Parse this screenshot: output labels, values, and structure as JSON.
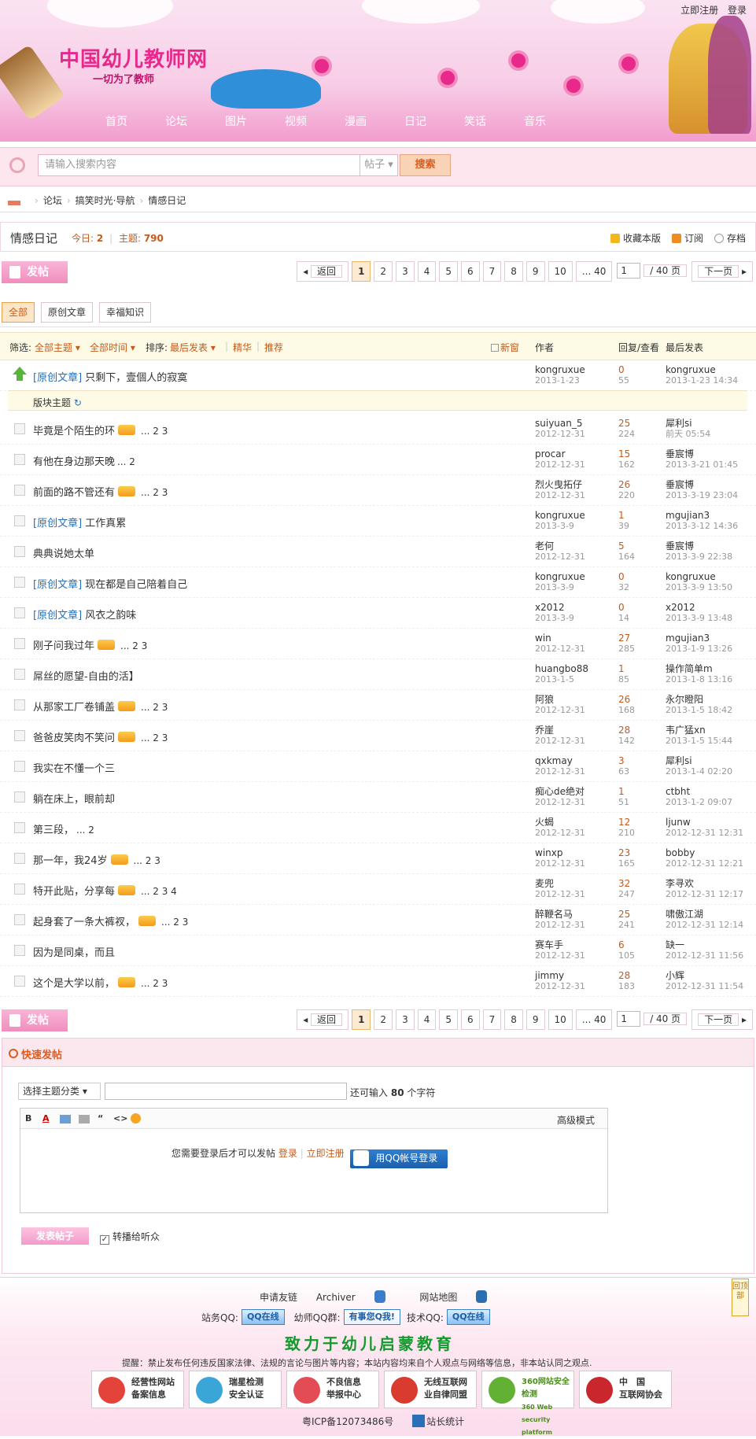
{
  "topbar": {
    "register": "立即注册",
    "login": "登录"
  },
  "header": {
    "site_name": "中国幼儿教师网",
    "slogan": "一切为了教师",
    "nav": [
      "首页",
      "论坛",
      "图片",
      "视频",
      "漫画",
      "日记",
      "笑话",
      "音乐"
    ]
  },
  "search": {
    "placeholder": "请输入搜索内容",
    "type": "帖子",
    "button": "搜索"
  },
  "breadcrumb": [
    "论坛",
    "搞笑时光·导航",
    "情感日记"
  ],
  "forum": {
    "name": "情感日记",
    "today_label": "今日:",
    "today": "2",
    "threads_label": "主题:",
    "threads": "790",
    "actions": {
      "favorite": "收藏本版",
      "subscribe": "订阅",
      "archive": "存档"
    }
  },
  "pager": {
    "post": "发帖",
    "back": "返回",
    "pages": [
      "1",
      "2",
      "3",
      "4",
      "5",
      "6",
      "7",
      "8",
      "9",
      "10",
      "... 40"
    ],
    "current": "1",
    "total": "/ 40 页",
    "next": "下一页"
  },
  "type_tabs": [
    "全部",
    "原创文章",
    "幸福知识"
  ],
  "list_header": {
    "filter": "筛选:",
    "all_topics": "全部主题",
    "all_time": "全部时间",
    "sort": "排序:",
    "latest": "最后发表",
    "digest": "精华",
    "recommend": "推荐",
    "new_window": "新窗",
    "author": "作者",
    "reply_view": "回复/查看",
    "last_post": "最后发表"
  },
  "sticky": {
    "tag": "[原创文章]",
    "title": "只剩下，壹個人的寂寞",
    "author": "kongruxue",
    "date": "2013-1-23",
    "replies": "0",
    "views": "55",
    "last_user": "kongruxue",
    "last_time": "2013-1-23 14:34"
  },
  "section_label": "版块主题",
  "threads": [
    {
      "tag": "",
      "title": "毕竟是个陌生的环",
      "hot": true,
      "pages": "... 2 3",
      "author": "suiyuan_5",
      "date": "2012-12-31",
      "replies": "25",
      "views": "224",
      "last_user": "犀利si",
      "last_time": "前天 05:54"
    },
    {
      "tag": "",
      "title": "有他在身边那天晚",
      "hot": false,
      "pages": "... 2",
      "author": "procar",
      "date": "2012-12-31",
      "replies": "15",
      "views": "162",
      "last_user": "垂宸博",
      "last_time": "2013-3-21 01:45"
    },
    {
      "tag": "",
      "title": "前面的路不管还有",
      "hot": true,
      "pages": "... 2 3",
      "author": "烈火曳拓仔",
      "date": "2012-12-31",
      "replies": "26",
      "views": "220",
      "last_user": "垂宸博",
      "last_time": "2013-3-19 23:04"
    },
    {
      "tag": "[原创文章]",
      "title": "工作真累",
      "hot": false,
      "pages": "",
      "author": "kongruxue",
      "date": "2013-3-9",
      "replies": "1",
      "views": "39",
      "last_user": "mgujian3",
      "last_time": "2013-3-12 14:36"
    },
    {
      "tag": "",
      "title": "典典说她太单",
      "hot": false,
      "pages": "",
      "author": "老何",
      "date": "2012-12-31",
      "replies": "5",
      "views": "164",
      "last_user": "垂宸博",
      "last_time": "2013-3-9 22:38"
    },
    {
      "tag": "[原创文章]",
      "title": "现在都是自己陪着自己",
      "hot": false,
      "pages": "",
      "author": "kongruxue",
      "date": "2013-3-9",
      "replies": "0",
      "views": "32",
      "last_user": "kongruxue",
      "last_time": "2013-3-9 13:50"
    },
    {
      "tag": "[原创文章]",
      "title": "风衣之韵味",
      "hot": false,
      "pages": "",
      "author": "x2012",
      "date": "2013-3-9",
      "replies": "0",
      "views": "14",
      "last_user": "x2012",
      "last_time": "2013-3-9 13:48"
    },
    {
      "tag": "",
      "title": "刚子问我过年",
      "hot": true,
      "pages": "... 2 3",
      "author": "win",
      "date": "2012-12-31",
      "replies": "27",
      "views": "285",
      "last_user": "mgujian3",
      "last_time": "2013-1-9 13:26"
    },
    {
      "tag": "",
      "title": "屌丝的愿望-自由的活】",
      "hot": false,
      "pages": "",
      "author": "huangbo88",
      "date": "2013-1-5",
      "replies": "1",
      "views": "85",
      "last_user": "操作简单m",
      "last_time": "2013-1-8 13:16"
    },
    {
      "tag": "",
      "title": "从那家工厂卷铺盖",
      "hot": true,
      "pages": "... 2 3",
      "author": "阿狼",
      "date": "2012-12-31",
      "replies": "26",
      "views": "168",
      "last_user": "永尔瞪阳",
      "last_time": "2013-1-5 18:42"
    },
    {
      "tag": "",
      "title": "爸爸皮笑肉不笑问",
      "hot": true,
      "pages": "... 2 3",
      "author": "乔崖",
      "date": "2012-12-31",
      "replies": "28",
      "views": "142",
      "last_user": "韦广猛xn",
      "last_time": "2013-1-5 15:44"
    },
    {
      "tag": "",
      "title": "我实在不懂一个三",
      "hot": false,
      "pages": "",
      "author": "qxkmay",
      "date": "2012-12-31",
      "replies": "3",
      "views": "63",
      "last_user": "犀利si",
      "last_time": "2013-1-4 02:20"
    },
    {
      "tag": "",
      "title": "躺在床上，眼前却",
      "hot": false,
      "pages": "",
      "author": "痴心de绝对",
      "date": "2012-12-31",
      "replies": "1",
      "views": "51",
      "last_user": "ctbht",
      "last_time": "2013-1-2 09:07"
    },
    {
      "tag": "",
      "title": "第三段，",
      "hot": false,
      "pages": "... 2",
      "author": "火蝎",
      "date": "2012-12-31",
      "replies": "12",
      "views": "210",
      "last_user": "ljunw",
      "last_time": "2012-12-31 12:31"
    },
    {
      "tag": "",
      "title": "那一年，我24岁",
      "hot": true,
      "pages": "... 2 3",
      "author": "winxp",
      "date": "2012-12-31",
      "replies": "23",
      "views": "165",
      "last_user": "bobby",
      "last_time": "2012-12-31 12:21"
    },
    {
      "tag": "",
      "title": "特开此贴，分享每",
      "hot": true,
      "pages": "... 2 3 4",
      "author": "麦兜",
      "date": "2012-12-31",
      "replies": "32",
      "views": "247",
      "last_user": "李寻欢",
      "last_time": "2012-12-31 12:17"
    },
    {
      "tag": "",
      "title": "起身套了一条大裤衩，",
      "hot": true,
      "pages": "... 2 3",
      "author": "醉鞭名马",
      "date": "2012-12-31",
      "replies": "25",
      "views": "241",
      "last_user": "啸傲江湖",
      "last_time": "2012-12-31 12:14"
    },
    {
      "tag": "",
      "title": "因为是同桌，而且",
      "hot": false,
      "pages": "",
      "author": "赛车手",
      "date": "2012-12-31",
      "replies": "6",
      "views": "105",
      "last_user": "缺一",
      "last_time": "2012-12-31 11:56"
    },
    {
      "tag": "",
      "title": "这个是大学以前，",
      "hot": true,
      "pages": "... 2 3",
      "author": "jimmy",
      "date": "2012-12-31",
      "replies": "28",
      "views": "183",
      "last_user": "小辉",
      "last_time": "2012-12-31 11:54"
    }
  ],
  "quick_post": {
    "heading": "快速发帖",
    "category": "选择主题分类",
    "remain_prefix": "还可输入",
    "remain": "80",
    "remain_suffix": "个字符",
    "advanced": "高级模式",
    "login_msg": "您需要登录后才可以发帖",
    "login": "登录",
    "register": "立即注册",
    "qq_login": "用QQ帐号登录",
    "submit": "发表帖子",
    "share": "转播给听众"
  },
  "footer": {
    "links": [
      "申请友链",
      "Archiver",
      "网站地图"
    ],
    "site_qq_label": "站务QQ:",
    "qq_online": "QQ在线",
    "group_label": "幼师QQ群:",
    "group_btn": "有事您Q我!",
    "tech_label": "技术QQ:",
    "slogan": "致力于幼儿启蒙教育",
    "notice": "提醒：禁止发布任何违反国家法律、法规的言论与图片等内容；本站内容均来自个人观点与网络等信息，非本站认同之观点.",
    "badges": [
      [
        "经营性网站",
        "备案信息"
      ],
      [
        "瑞星检测",
        "安全认证"
      ],
      [
        "不良信息",
        "举报中心"
      ],
      [
        "无线互联网",
        "业自律同盟"
      ],
      [
        "360网站安全检测",
        "360 Web security platform"
      ],
      [
        "中　国",
        "互联网协会"
      ]
    ],
    "icp": "粤ICP备12073486号",
    "stats": "站长统计",
    "back_top": "回顶部"
  }
}
